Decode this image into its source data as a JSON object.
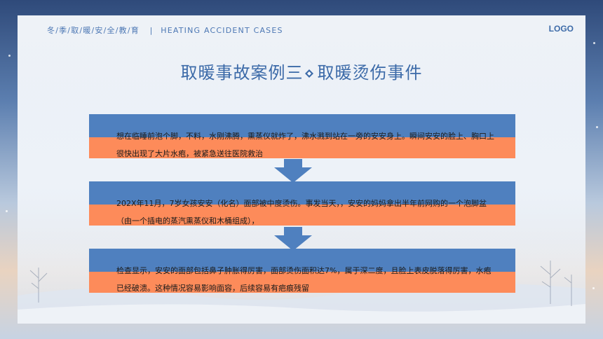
{
  "header": {
    "series_cn": "冬/季/取/暖/安/全/教/育",
    "separator": "|",
    "series_en": "HEATING  ACCIDENT  CASES",
    "logo": "LOGO"
  },
  "title": {
    "part1": "取暖事故案例三",
    "part2": "取暖烫伤事件"
  },
  "cases": [
    {
      "text": "想在临睡前泡个脚，不料，水刚沸腾，熏蒸仪就炸了，沸水溅到站在一旁的安安身上。瞬间安安的脸上、胸口上很快出现了大片水疱，被紧急送往医院救治"
    },
    {
      "text": "202X年11月，7岁女孩安安（化名）面部被中度烫伤。事发当天，，安安的妈妈拿出半年前网购的一个泡脚盆（由一个插电的蒸汽熏蒸仪和木桶组成），"
    },
    {
      "text": "检查显示，安安的面部包括鼻子肿胀得厉害，面部烫伤面积达7%，属于深二度，且脸上表皮脱落得厉害，水疱已经破溃。这种情况容易影响面容，后续容易有疤痕残留"
    }
  ],
  "colors": {
    "blue_band": "#4f80bf",
    "orange_band": "#fd8b5a",
    "accent_text": "#3c6aa8"
  }
}
